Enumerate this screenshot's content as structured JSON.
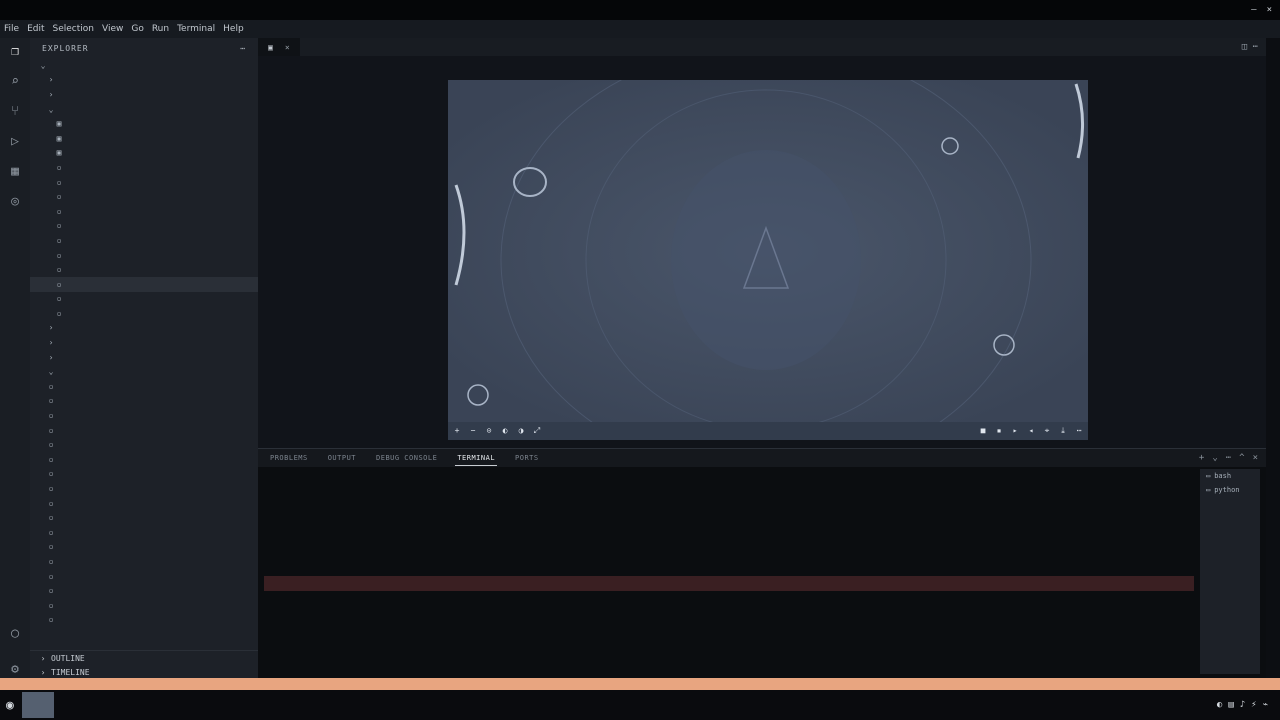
{
  "window": {
    "title": "",
    "controls": [
      "–",
      "×"
    ]
  },
  "menu": {
    "items": [
      "File",
      "Edit",
      "Selection",
      "View",
      "Go",
      "Run",
      "Terminal",
      "Help"
    ]
  },
  "sidebar": {
    "header": "EXPLORER",
    "items": [
      {
        "label": "",
        "icon": "chevron-down-icon",
        "indent": 0
      },
      {
        "label": "",
        "icon": "chevron-right-icon",
        "indent": 1
      },
      {
        "label": "",
        "icon": "chevron-right-icon",
        "indent": 1
      },
      {
        "label": "",
        "icon": "chevron-down-icon",
        "indent": 1
      },
      {
        "label": "",
        "icon": "image-icon",
        "indent": 2
      },
      {
        "label": "",
        "icon": "image-icon",
        "indent": 2
      },
      {
        "label": "",
        "icon": "image-icon",
        "indent": 2
      },
      {
        "label": "",
        "icon": "file-icon",
        "indent": 2,
        "badge": ""
      },
      {
        "label": "",
        "icon": "file-icon",
        "indent": 2,
        "badge": ""
      },
      {
        "label": "",
        "icon": "file-icon",
        "indent": 2,
        "badge": ""
      },
      {
        "label": "",
        "icon": "file-icon",
        "indent": 2,
        "badge": ""
      },
      {
        "label": "",
        "icon": "file-icon",
        "indent": 2,
        "badge": ""
      },
      {
        "label": "",
        "icon": "file-icon",
        "indent": 2,
        "badge": ""
      },
      {
        "label": "",
        "icon": "file-icon",
        "indent": 2,
        "badge": "",
        "modified": true
      },
      {
        "label": "",
        "icon": "file-icon",
        "indent": 2,
        "badge": "",
        "modified": true
      },
      {
        "label": "",
        "icon": "file-icon",
        "indent": 2,
        "badge": "",
        "modified": true,
        "selected": true
      },
      {
        "label": "",
        "icon": "file-icon",
        "indent": 2,
        "badge": "",
        "modified": true
      },
      {
        "label": "",
        "icon": "file-icon",
        "indent": 2,
        "badge": "",
        "modified": true
      },
      {
        "label": "",
        "icon": "chevron-right-icon",
        "indent": 1
      },
      {
        "label": "",
        "icon": "chevron-right-icon",
        "indent": 1
      },
      {
        "label": "",
        "icon": "chevron-right-icon",
        "indent": 1
      },
      {
        "label": "",
        "icon": "chevron-down-icon",
        "indent": 1
      },
      {
        "label": "",
        "icon": "file-icon",
        "indent": 1,
        "badge": ""
      },
      {
        "label": "",
        "icon": "file-icon",
        "indent": 1
      },
      {
        "label": "",
        "icon": "file-icon",
        "indent": 1
      },
      {
        "label": "",
        "icon": "file-icon",
        "indent": 1
      },
      {
        "label": "",
        "icon": "file-icon",
        "indent": 1
      },
      {
        "label": "",
        "icon": "file-icon",
        "indent": 1
      },
      {
        "label": "",
        "icon": "file-icon",
        "indent": 1
      },
      {
        "label": "",
        "icon": "file-icon",
        "indent": 1
      },
      {
        "label": "",
        "icon": "file-icon",
        "indent": 1
      },
      {
        "label": "",
        "icon": "file-icon",
        "indent": 1
      },
      {
        "label": "",
        "icon": "file-icon",
        "indent": 1
      },
      {
        "label": "",
        "icon": "file-icon",
        "indent": 1
      },
      {
        "label": "",
        "icon": "file-icon",
        "indent": 1
      },
      {
        "label": "",
        "icon": "file-icon",
        "indent": 1
      },
      {
        "label": "",
        "icon": "file-icon",
        "indent": 1
      },
      {
        "label": "",
        "icon": "file-icon",
        "indent": 1
      },
      {
        "label": "",
        "icon": "file-icon",
        "indent": 1
      }
    ],
    "outline": [
      "OUTLINE",
      "TIMELINE"
    ]
  },
  "editor": {
    "tab": {
      "label": "",
      "close": "×"
    },
    "breadcrumb": ""
  },
  "preview": {
    "background": "#3f4a5c",
    "toolbar_left": [
      "+",
      "−",
      "⊙",
      "◐",
      "◑",
      "⤢"
    ],
    "toolbar_right": [
      "■",
      "▪",
      "▸",
      "◂",
      "⌖",
      "⤓",
      "⋯"
    ]
  },
  "panel": {
    "tabs": [
      {
        "label": "PROBLEMS",
        "active": false
      },
      {
        "label": "OUTPUT",
        "active": false
      },
      {
        "label": "DEBUG CONSOLE",
        "active": false
      },
      {
        "label": "TERMINAL",
        "active": true
      },
      {
        "label": "PORTS",
        "active": false
      }
    ],
    "actions": [
      "+",
      "⌄",
      "⋯",
      "^",
      "×"
    ],
    "terminal_lines": [
      {
        "text": "",
        "style": "cmd"
      },
      {
        "text": "",
        "style": "plain"
      },
      {
        "text": "",
        "style": "plain"
      },
      {
        "text": "",
        "style": "info"
      },
      {
        "text": "",
        "style": "info-y"
      },
      {
        "text": "",
        "style": "info"
      },
      {
        "text": "",
        "style": "info"
      },
      {
        "text": "",
        "style": "error"
      },
      {
        "text": "",
        "style": "plain"
      },
      {
        "text": "",
        "style": "plain"
      },
      {
        "text": "",
        "style": "plain"
      },
      {
        "text": "",
        "style": "cmd"
      },
      {
        "text": "",
        "style": "cmd"
      }
    ],
    "terminal_list": [
      {
        "label": "bash",
        "icon": "terminal-icon"
      },
      {
        "label": "python",
        "icon": "terminal-icon"
      }
    ]
  },
  "status": {
    "left": "",
    "right": ""
  },
  "taskbar": {
    "start_icon": "start-icon",
    "clock": ""
  }
}
